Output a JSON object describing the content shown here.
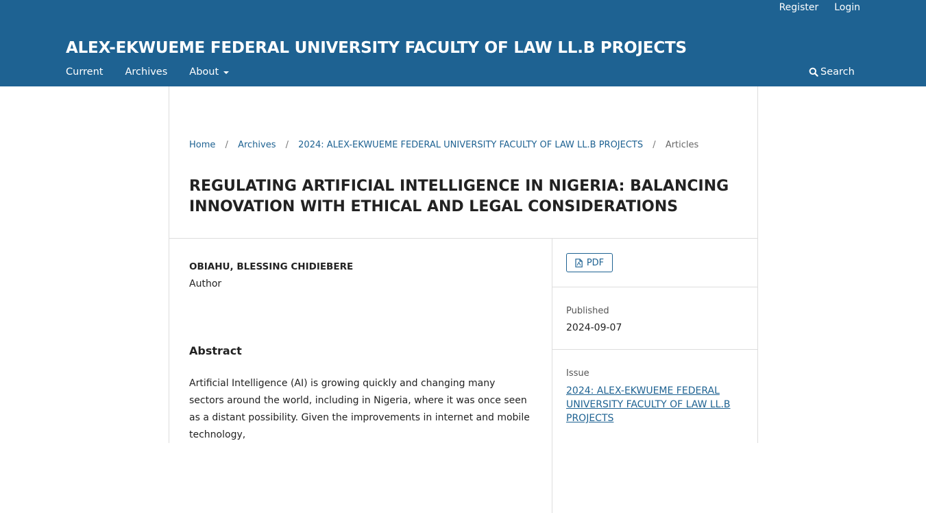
{
  "user_nav": {
    "register": "Register",
    "login": "Login"
  },
  "site_title": "ALEX-EKWUEME FEDERAL UNIVERSITY FACULTY OF LAW LL.B PROJECTS",
  "primary_nav": {
    "current": "Current",
    "archives": "Archives",
    "about": "About",
    "search": "Search"
  },
  "breadcrumb": {
    "home": "Home",
    "archives": "Archives",
    "issue": "2024: ALEX-EKWUEME FEDERAL UNIVERSITY FACULTY OF LAW LL.B PROJECTS",
    "current": "Articles",
    "separator": "/"
  },
  "article": {
    "title": "REGULATING ARTIFICIAL INTELLIGENCE IN NIGERIA: BALANCING INNOVATION WITH ETHICAL AND LEGAL CONSIDERATIONS",
    "author_name": "OBIAHU, BLESSING CHIDIEBERE",
    "author_role": "Author",
    "abstract_heading": "Abstract",
    "abstract_text": "Artificial Intelligence (AI) is growing quickly and changing many sectors around the world, including in Nigeria, where it was once seen as a distant possibility. Given the improvements in internet and mobile technology,"
  },
  "sidebar": {
    "pdf_label": "PDF",
    "published_label": "Published",
    "published_value": "2024-09-07",
    "issue_label": "Issue",
    "issue_value": "2024: ALEX-EKWUEME FEDERAL UNIVERSITY FACULTY OF LAW LL.B PROJECTS"
  },
  "colors": {
    "brand": "#1e6292",
    "text": "#222222",
    "border": "#dddddd"
  },
  "icons": {
    "search": "search-icon",
    "pdf": "file-pdf-icon",
    "caret": "caret-down-icon"
  }
}
